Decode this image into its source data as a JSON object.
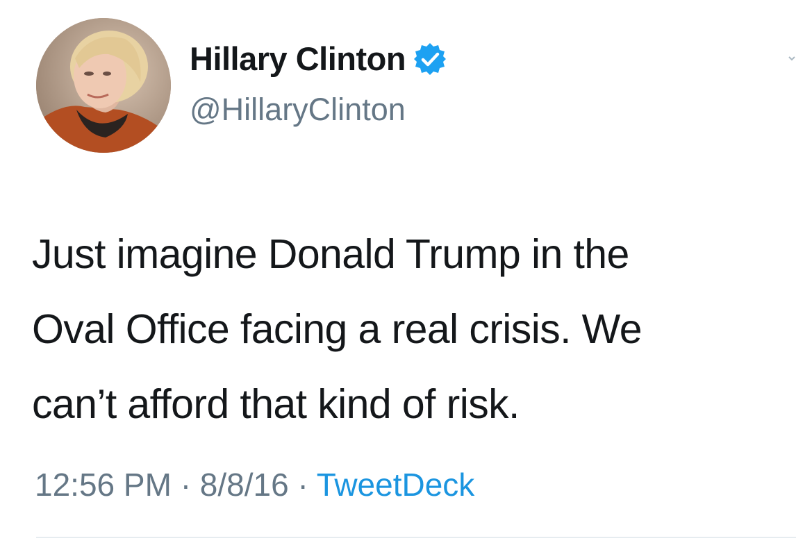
{
  "tweet": {
    "author": {
      "display_name": "Hillary Clinton",
      "handle": "@HillaryClinton",
      "verified": true,
      "avatar_icon": "profile-photo-avatar"
    },
    "text": "Just imagine Donald Trump in the\nOval Office facing a real crisis. We\ncan’t afford that kind of risk.",
    "time": "12:56 PM",
    "separator": "·",
    "date": "8/8/16",
    "source": "TweetDeck"
  },
  "colors": {
    "text_primary": "#14171a",
    "text_secondary": "#657786",
    "link_blue": "#1b95e0",
    "verified_blue": "#1da1f2",
    "divider": "#e6ecf0"
  },
  "icons": {
    "verified": "verified-badge-icon",
    "menu": "chevron-down-icon"
  }
}
